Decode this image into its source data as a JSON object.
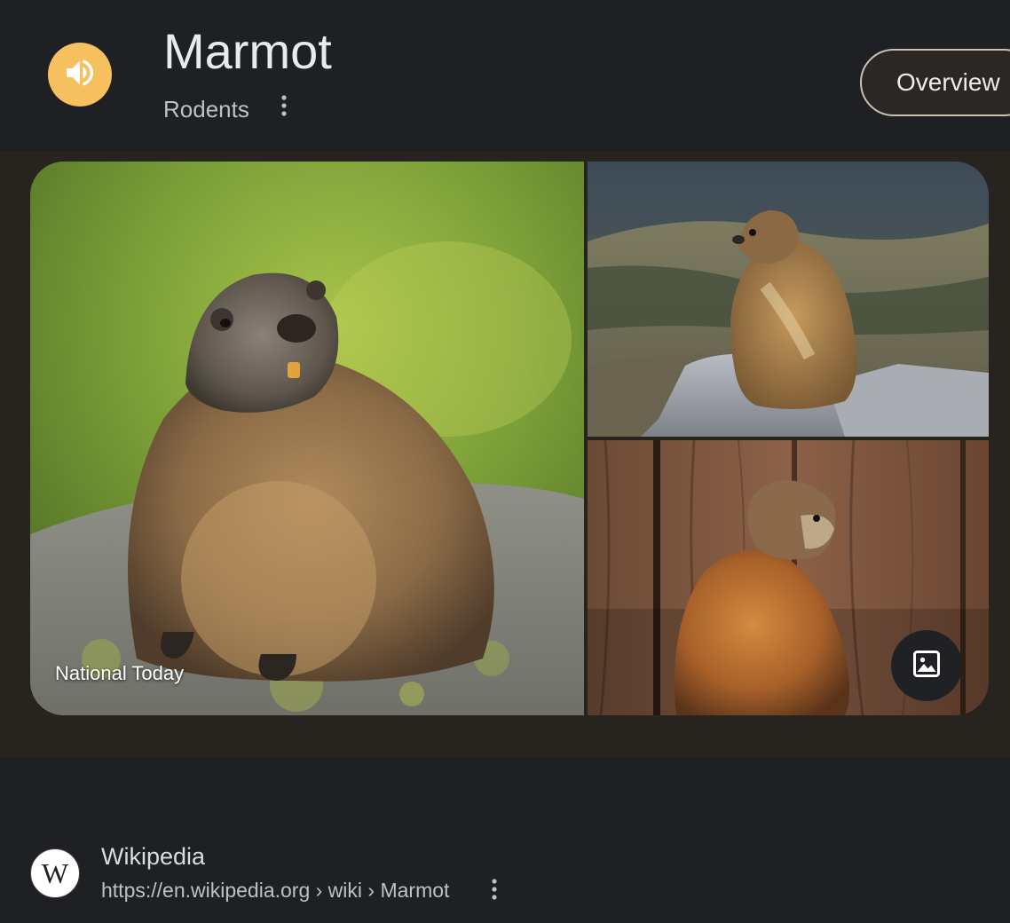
{
  "header": {
    "title": "Marmot",
    "subtitle": "Rodents",
    "speaker_icon": "volume-up-icon",
    "more_icon": "more-vert-icon",
    "overview_tab": "Overview",
    "accent_color": "#f7c05e"
  },
  "images": {
    "main_source": "National Today",
    "more_images_icon": "image-icon"
  },
  "result": {
    "favicon_letter": "W",
    "site_name": "Wikipedia",
    "url": "https://en.wikipedia.org › wiki › Marmot",
    "more_icon": "more-vert-icon"
  }
}
